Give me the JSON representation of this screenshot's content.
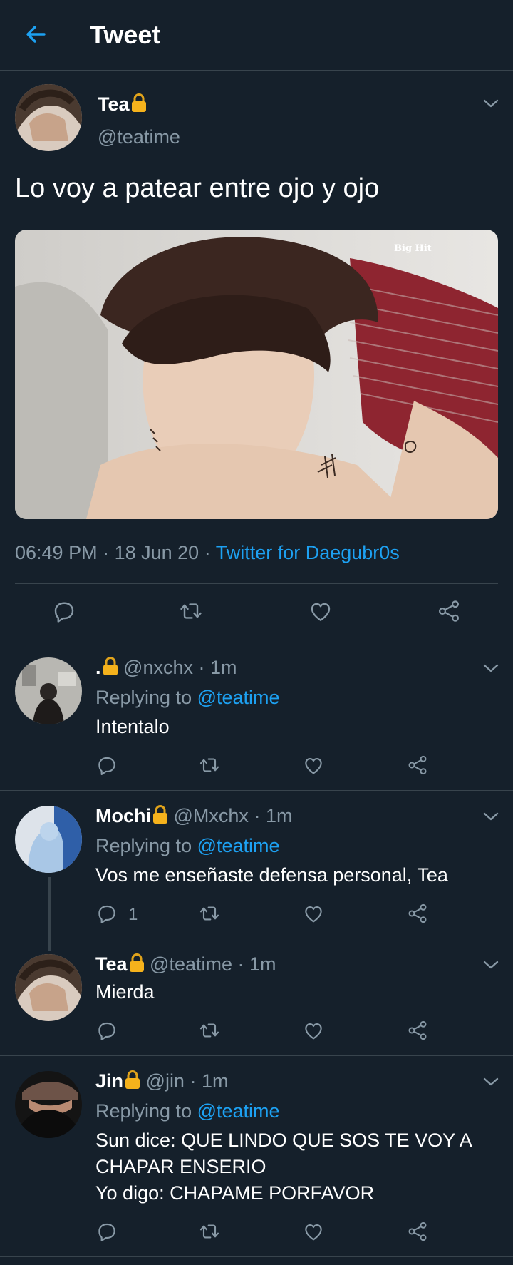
{
  "header": {
    "title": "Tweet"
  },
  "main": {
    "name": "Tea",
    "handle": "@teatime",
    "text": "Lo voy a patear entre ojo y ojo",
    "image_watermark": "Big Hit",
    "time": "06:49 PM",
    "date": "18 Jun 20",
    "source": "Twitter for Daegubr0s"
  },
  "replies": [
    {
      "name": ".",
      "handle": "@nxchx",
      "time": "1m",
      "replying_prefix": "Replying to",
      "replying_to": "@teatime",
      "text": "Intentalo",
      "reply_count": ""
    },
    {
      "name": "Mochi",
      "handle": "@Mxchx",
      "time": "1m",
      "replying_prefix": "Replying to",
      "replying_to": "@teatime",
      "text": "Vos me enseñaste defensa personal, Tea",
      "reply_count": "1"
    },
    {
      "name": "Tea",
      "handle": "@teatime",
      "time": "1m",
      "text": "Mierda"
    },
    {
      "name": "Jin",
      "handle": "@jin",
      "time": "1m",
      "replying_prefix": "Replying to",
      "replying_to": "@teatime",
      "text_line1": "Sun dice: QUE LINDO QUE SOS TE VOY A",
      "text_line2": "CHAPAR ENSERIO",
      "text_line3": "Yo digo: CHAPAME PORFAVOR"
    }
  ],
  "colors": {
    "background": "#15202b",
    "accent": "#1da1f2",
    "muted": "#8899a6",
    "divider": "#38444d",
    "lock": "#f5b21c"
  },
  "icons": [
    "back-arrow-icon",
    "chevron-down-icon",
    "lock-icon",
    "reply-icon",
    "retweet-icon",
    "like-icon",
    "share-icon"
  ]
}
